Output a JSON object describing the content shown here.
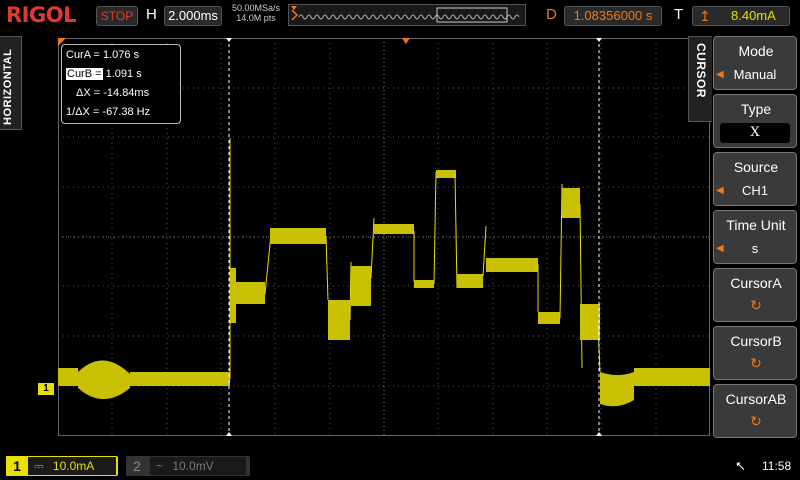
{
  "brand": "RIGOL",
  "status": "STOP",
  "horizontal": {
    "letter": "H",
    "timebase": "2.000ms",
    "rate_line1": "50.00MSa/s",
    "rate_line2": "14.0M pts"
  },
  "delay": {
    "letter": "D",
    "value": "1.08356000 s"
  },
  "trigger": {
    "letter": "T",
    "level": "8.40mA"
  },
  "left_tab": "HORIZONTAL",
  "right_tab": "CURSOR",
  "cursor_info": {
    "cur_a_label": "CurA =",
    "cur_a": "1.076 s",
    "cur_b_label": "CurB =",
    "cur_b": "1.091 s",
    "delta_x_label": "ΔX =",
    "delta_x": "-14.84ms",
    "inv_delta_x_label": "1/ΔX =",
    "inv_delta_x": "-67.38 Hz"
  },
  "menu": [
    {
      "label": "Mode",
      "value": "Manual",
      "has_arrow": true
    },
    {
      "label": "Type",
      "value": "X",
      "has_arrow": false
    },
    {
      "label": "Source",
      "value": "CH1",
      "has_arrow": true
    },
    {
      "label": "Time Unit",
      "value": "s",
      "has_arrow": true
    },
    {
      "label": "CursorA",
      "icon": "rotary-knob-icon"
    },
    {
      "label": "CursorB",
      "icon": "rotary-knob-icon"
    },
    {
      "label": "CursorAB",
      "icon": "rotary-knob-icon"
    }
  ],
  "channels": [
    {
      "number": "1",
      "coupling": "⎓",
      "scale": "10.0mA",
      "active": true
    },
    {
      "number": "2",
      "coupling": "~",
      "scale": "10.0mV",
      "active": false
    }
  ],
  "clock": "11:58",
  "ch1_marker": "1",
  "colors": {
    "ch1": "#e8e000",
    "accent": "#f07818",
    "logo": "#e23a2a"
  }
}
